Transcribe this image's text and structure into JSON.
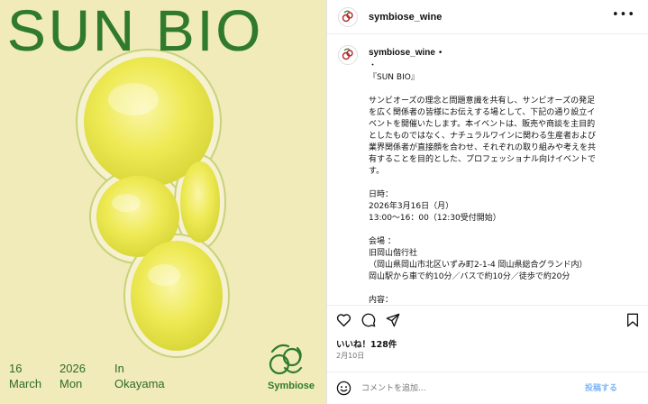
{
  "poster": {
    "title": "SUN BIO",
    "meta": [
      {
        "top": "16",
        "bottom": "March"
      },
      {
        "top": "2026",
        "bottom": "Mon"
      },
      {
        "top": "In",
        "bottom": "Okayama"
      }
    ],
    "brand": "Symbiose",
    "colors": {
      "background": "#f1ebb9",
      "accent": "#2f7a2c",
      "bubble": "#ecec3a"
    }
  },
  "header": {
    "username": "symbiose_wine",
    "more_icon": "more-horizontal-icon"
  },
  "caption": {
    "username": "symbiose_wine",
    "dot": "•",
    "lines": [
      "・",
      "『SUN BIO』",
      "",
      "サンビオーズの理念と問題意識を共有し、サンビオーズの発足",
      "を広く関係者の皆様にお伝えする場として、下記の通り設立イ",
      "ベントを開催いたします。本イベントは、販売や商談を主目的",
      "としたものではなく、ナチュラルワインに関わる生産者および",
      "業界関係者が直接顔を合わせ、それぞれの取り組みや考えを共",
      "有することを目的とした、プロフェッショナル向けイベントで",
      "す。",
      "",
      "日時：",
      "2026年3月16日（月）",
      "13:00～16：00（12:30受付開始）",
      "",
      "会場 ：",
      "旧岡山偕行社",
      "（岡山県岡山市北区いずみ町2-1-4 岡山県総合グランド内）",
      "岡山駅から車で約10分／バスで約10分／徒歩で約20分",
      "",
      "内容："
    ]
  },
  "actions": {
    "icons": [
      "heart-icon",
      "comment-icon",
      "share-icon",
      "bookmark-icon"
    ]
  },
  "likes": "いいね！128件",
  "date": "2月10日",
  "comment": {
    "placeholder": "コメントを追加...",
    "post_label": "投稿する"
  }
}
